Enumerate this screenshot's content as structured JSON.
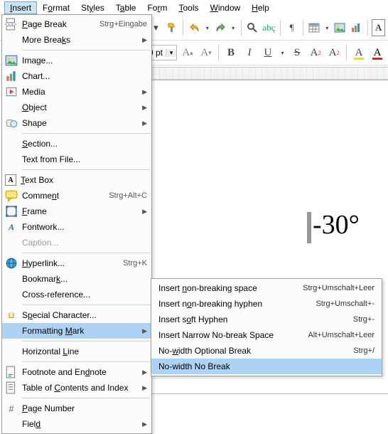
{
  "menubar": {
    "insert": "Insert",
    "format": "Format",
    "styles": "Styles",
    "table": "Table",
    "form": "Form",
    "tools": "Tools",
    "window": "Window",
    "help": "Help"
  },
  "toolbar2": {
    "fontsize": "0 pt"
  },
  "document": {
    "text": "-30°"
  },
  "insertMenu": {
    "pageBreak": "Page Break",
    "pageBreakAccel": "Strg+Eingabe",
    "moreBreaks": "More Breaks",
    "image": "Image...",
    "chart": "Chart...",
    "media": "Media",
    "object": "Object",
    "shape": "Shape",
    "section": "Section...",
    "textFromFile": "Text from File...",
    "textBox": "Text Box",
    "comment": "Comment",
    "commentAccel": "Strg+Alt+C",
    "frame": "Frame",
    "fontwork": "Fontwork...",
    "caption": "Caption...",
    "hyperlink": "Hyperlink...",
    "hyperlinkAccel": "Strg+K",
    "bookmark": "Bookmark...",
    "crossRef": "Cross-reference...",
    "specialChar": "Special Character...",
    "formattingMark": "Formatting Mark",
    "horizontalLine": "Horizontal Line",
    "footnote": "Footnote and Endnote",
    "toc": "Table of Contents and Index",
    "pageNumber": "Page Number",
    "field": "Field"
  },
  "formattingSubmenu": {
    "nbsp": "Insert non-breaking space",
    "nbspAccel": "Strg+Umschalt+Leer",
    "nbhyphen": "Insert non-breaking hyphen",
    "nbhyphenAccel": "Strg+Umschalt+-",
    "softHyphen": "Insert soft Hyphen",
    "softHyphenAccel": "Strg+-",
    "narrowNbsp": "Insert Narrow No-break Space",
    "narrowNbspAccel": "Alt+Umschalt+Leer",
    "nwOptBreak": "No-width Optional Break",
    "nwOptBreakAccel": "Strg+/",
    "nwNoBreak": "No-width No Break"
  }
}
